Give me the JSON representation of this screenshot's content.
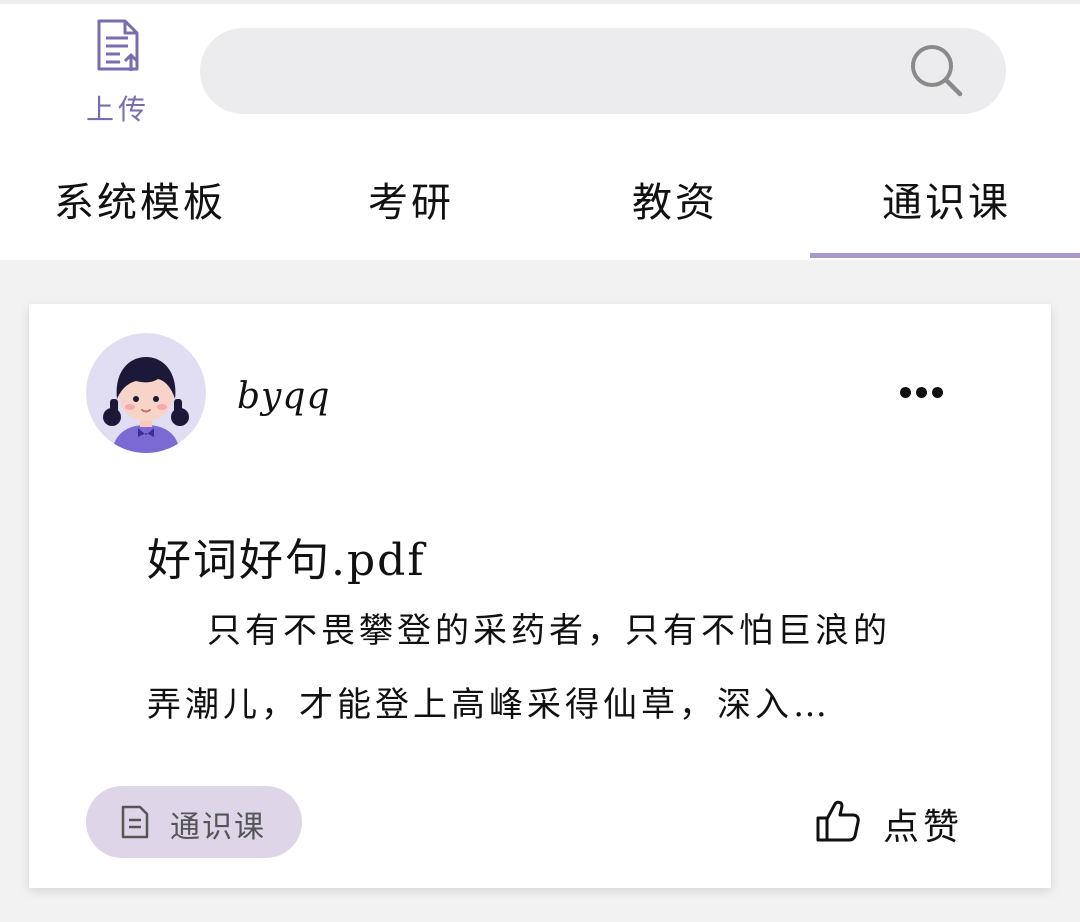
{
  "header": {
    "upload_label": "上传",
    "search_placeholder": "",
    "icons": {
      "upload": "upload-document-icon",
      "search": "search-icon"
    }
  },
  "tabs": [
    {
      "label": "系统模板",
      "selected": false
    },
    {
      "label": "考研",
      "selected": false
    },
    {
      "label": "教资",
      "selected": false
    },
    {
      "label": "通识课",
      "selected": true
    }
  ],
  "colors": {
    "accent": "#a899cc",
    "upload_icon": "#7b6bb0",
    "tag_background": "#ded6e8",
    "search_background": "#ececee",
    "page_background": "#f2f2f2"
  },
  "post": {
    "username": "byqq",
    "avatar_icon": "girl-avatar-icon",
    "more_icon": "more-dots-icon",
    "title": "好词好句.pdf",
    "excerpt": "只有不畏攀登的采药者，只有不怕巨浪的弄潮儿，才能登上高峰采得仙草，深入…",
    "tag": {
      "label": "通识课",
      "icon": "document-icon"
    },
    "like": {
      "label": "点赞",
      "icon": "thumbs-up-icon"
    }
  }
}
